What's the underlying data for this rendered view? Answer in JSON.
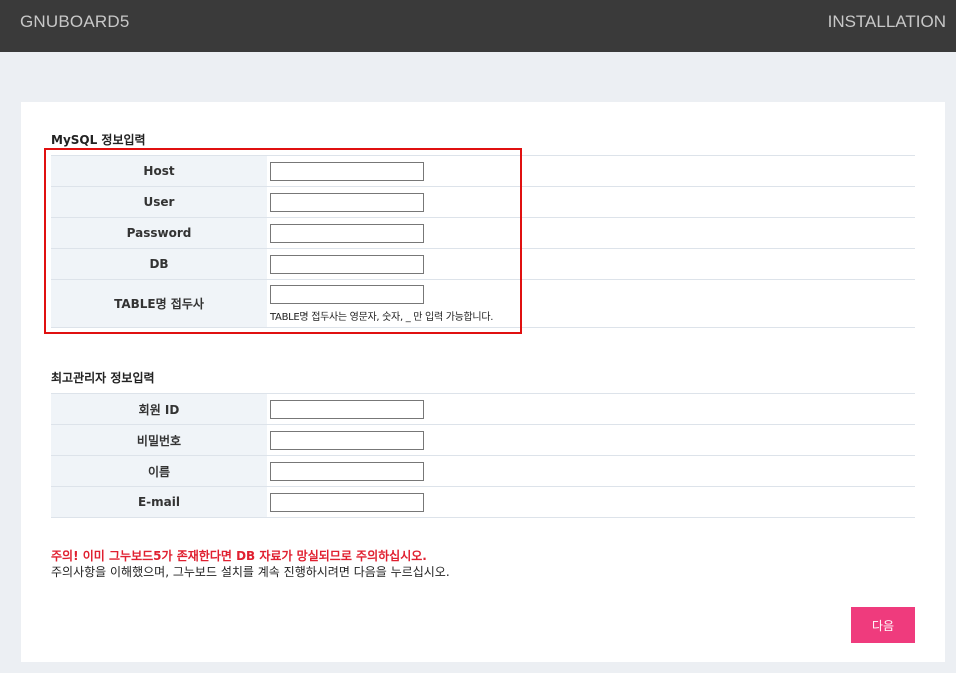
{
  "header": {
    "brand": "GNUBOARD5",
    "step_label": "INSTALLATION"
  },
  "mysql": {
    "title": "MySQL 정보입력",
    "fields": [
      {
        "label": "Host",
        "value": ""
      },
      {
        "label": "User",
        "value": ""
      },
      {
        "label": "Password",
        "value": ""
      },
      {
        "label": "DB",
        "value": ""
      },
      {
        "label": "TABLE명 접두사",
        "value": "",
        "help": "TABLE명 접두사는 영문자, 숫자, _ 만 입력 가능합니다."
      }
    ]
  },
  "admin": {
    "title": "최고관리자 정보입력",
    "fields": [
      {
        "label": "회원 ID",
        "value": ""
      },
      {
        "label": "비밀번호",
        "value": ""
      },
      {
        "label": "이름",
        "value": ""
      },
      {
        "label": "E-mail",
        "value": ""
      }
    ]
  },
  "warning": "주의! 이미 그누보드5가 존재한다면 DB 자료가 망실되므로 주의하십시오.",
  "notice": "주의사항을 이해했으며, 그누보드 설치를 계속 진행하시려면 다음을 누르십시오.",
  "next_button": "다음",
  "colors": {
    "topbar": "#3a3a3a",
    "accent_button": "#ef3b7d",
    "warning_text": "#e02030",
    "highlight_box": "#e01010"
  }
}
